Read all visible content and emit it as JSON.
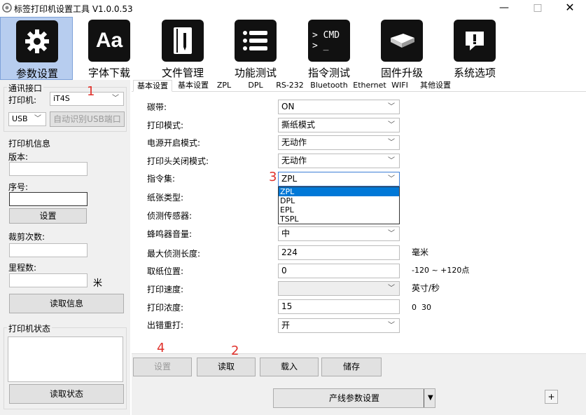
{
  "window": {
    "title": "标签打印机设置工具 V1.0.0.53",
    "minimize": "—",
    "maximize": "□",
    "close": "✕"
  },
  "toolbar": [
    {
      "label": "参数设置",
      "icon": "gear-icon",
      "glyph": "⚙"
    },
    {
      "label": "字体下载",
      "icon": "font-icon",
      "glyph": "Aa"
    },
    {
      "label": "文件管理",
      "icon": "file-icon",
      "glyph": "▤"
    },
    {
      "label": "功能测试",
      "icon": "list-icon",
      "glyph": "☰"
    },
    {
      "label": "指令测试",
      "icon": "cmd-icon",
      "glyph": "> CMD\n> _"
    },
    {
      "label": "固件升级",
      "icon": "chip-icon",
      "glyph": "▭"
    },
    {
      "label": "系统选项",
      "icon": "alert-icon",
      "glyph": "!"
    }
  ],
  "left": {
    "comm_group": "通讯接口",
    "printer_label": "打印机:",
    "printer_value": "iT4S",
    "port_value": "USB",
    "auto_detect": "自动识别USB端口",
    "info_group": "打印机信息",
    "version_label": "版本:",
    "version_value": "",
    "serial_label": "序号:",
    "serial_value": "",
    "set_button": "设置",
    "cut_label": "裁剪次数:",
    "cut_value": "",
    "mileage_label": "里程数:",
    "mileage_value": "",
    "mileage_unit": "米",
    "read_info_button": "读取信息",
    "status_group": "打印机状态",
    "status_text": "",
    "read_status_button": "读取状态"
  },
  "annotations": {
    "n1": "1",
    "n2": "2",
    "n3": "3",
    "n4": "4"
  },
  "tabs": [
    "基本设置",
    "基本设置",
    "ZPL",
    "DPL",
    "RS-232",
    "Bluetooth",
    "Ethernet",
    "WIFI",
    "其他设置"
  ],
  "fields": {
    "ribbon": {
      "label": "碳带:",
      "value": "ON"
    },
    "print_mode": {
      "label": "打印模式:",
      "value": "撕纸模式"
    },
    "power_on": {
      "label": "电源开启模式:",
      "value": "无动作"
    },
    "head_close": {
      "label": "打印头关闭模式:",
      "value": "无动作"
    },
    "command_set": {
      "label": "指令集:",
      "value": "ZPL"
    },
    "paper_type": {
      "label": "纸张类型:",
      "value": ""
    },
    "sensor": {
      "label": "侦测传感器:",
      "value": ""
    },
    "buzzer": {
      "label": "蜂鸣器音量:",
      "value": "中"
    },
    "max_detect": {
      "label": "最大侦测长度:",
      "value": "224",
      "unit": "毫米"
    },
    "tear_pos": {
      "label": "取纸位置:",
      "value": "0",
      "unit": "-120 ~ +120点"
    },
    "speed": {
      "label": "打印速度:",
      "value": "",
      "unit": "英寸/秒"
    },
    "density": {
      "label": "打印浓度:",
      "value": "15",
      "unit": "0  30"
    },
    "reprint": {
      "label": "出错重打:",
      "value": "开"
    }
  },
  "command_options": [
    "ZPL",
    "DPL",
    "EPL",
    "TSPL"
  ],
  "buttons": {
    "set": "设置",
    "read": "读取",
    "load": "载入",
    "save": "储存",
    "line_params": "产线参数设置",
    "plus": "+"
  }
}
